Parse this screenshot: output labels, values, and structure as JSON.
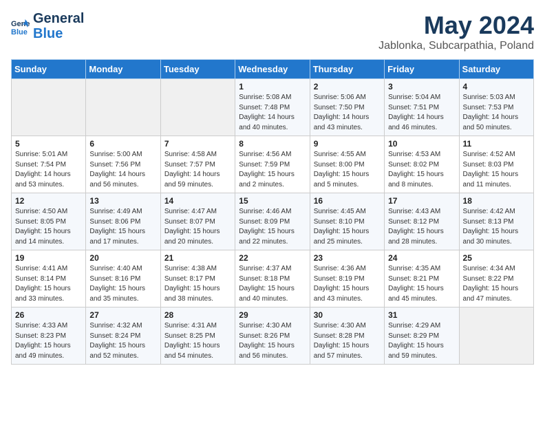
{
  "header": {
    "logo_line1": "General",
    "logo_line2": "Blue",
    "month_title": "May 2024",
    "subtitle": "Jablonka, Subcarpathia, Poland"
  },
  "days_of_week": [
    "Sunday",
    "Monday",
    "Tuesday",
    "Wednesday",
    "Thursday",
    "Friday",
    "Saturday"
  ],
  "weeks": [
    [
      {
        "day": "",
        "sunrise": "",
        "sunset": "",
        "daylight": ""
      },
      {
        "day": "",
        "sunrise": "",
        "sunset": "",
        "daylight": ""
      },
      {
        "day": "",
        "sunrise": "",
        "sunset": "",
        "daylight": ""
      },
      {
        "day": "1",
        "sunrise": "Sunrise: 5:08 AM",
        "sunset": "Sunset: 7:48 PM",
        "daylight": "Daylight: 14 hours and 40 minutes."
      },
      {
        "day": "2",
        "sunrise": "Sunrise: 5:06 AM",
        "sunset": "Sunset: 7:50 PM",
        "daylight": "Daylight: 14 hours and 43 minutes."
      },
      {
        "day": "3",
        "sunrise": "Sunrise: 5:04 AM",
        "sunset": "Sunset: 7:51 PM",
        "daylight": "Daylight: 14 hours and 46 minutes."
      },
      {
        "day": "4",
        "sunrise": "Sunrise: 5:03 AM",
        "sunset": "Sunset: 7:53 PM",
        "daylight": "Daylight: 14 hours and 50 minutes."
      }
    ],
    [
      {
        "day": "5",
        "sunrise": "Sunrise: 5:01 AM",
        "sunset": "Sunset: 7:54 PM",
        "daylight": "Daylight: 14 hours and 53 minutes."
      },
      {
        "day": "6",
        "sunrise": "Sunrise: 5:00 AM",
        "sunset": "Sunset: 7:56 PM",
        "daylight": "Daylight: 14 hours and 56 minutes."
      },
      {
        "day": "7",
        "sunrise": "Sunrise: 4:58 AM",
        "sunset": "Sunset: 7:57 PM",
        "daylight": "Daylight: 14 hours and 59 minutes."
      },
      {
        "day": "8",
        "sunrise": "Sunrise: 4:56 AM",
        "sunset": "Sunset: 7:59 PM",
        "daylight": "Daylight: 15 hours and 2 minutes."
      },
      {
        "day": "9",
        "sunrise": "Sunrise: 4:55 AM",
        "sunset": "Sunset: 8:00 PM",
        "daylight": "Daylight: 15 hours and 5 minutes."
      },
      {
        "day": "10",
        "sunrise": "Sunrise: 4:53 AM",
        "sunset": "Sunset: 8:02 PM",
        "daylight": "Daylight: 15 hours and 8 minutes."
      },
      {
        "day": "11",
        "sunrise": "Sunrise: 4:52 AM",
        "sunset": "Sunset: 8:03 PM",
        "daylight": "Daylight: 15 hours and 11 minutes."
      }
    ],
    [
      {
        "day": "12",
        "sunrise": "Sunrise: 4:50 AM",
        "sunset": "Sunset: 8:05 PM",
        "daylight": "Daylight: 15 hours and 14 minutes."
      },
      {
        "day": "13",
        "sunrise": "Sunrise: 4:49 AM",
        "sunset": "Sunset: 8:06 PM",
        "daylight": "Daylight: 15 hours and 17 minutes."
      },
      {
        "day": "14",
        "sunrise": "Sunrise: 4:47 AM",
        "sunset": "Sunset: 8:07 PM",
        "daylight": "Daylight: 15 hours and 20 minutes."
      },
      {
        "day": "15",
        "sunrise": "Sunrise: 4:46 AM",
        "sunset": "Sunset: 8:09 PM",
        "daylight": "Daylight: 15 hours and 22 minutes."
      },
      {
        "day": "16",
        "sunrise": "Sunrise: 4:45 AM",
        "sunset": "Sunset: 8:10 PM",
        "daylight": "Daylight: 15 hours and 25 minutes."
      },
      {
        "day": "17",
        "sunrise": "Sunrise: 4:43 AM",
        "sunset": "Sunset: 8:12 PM",
        "daylight": "Daylight: 15 hours and 28 minutes."
      },
      {
        "day": "18",
        "sunrise": "Sunrise: 4:42 AM",
        "sunset": "Sunset: 8:13 PM",
        "daylight": "Daylight: 15 hours and 30 minutes."
      }
    ],
    [
      {
        "day": "19",
        "sunrise": "Sunrise: 4:41 AM",
        "sunset": "Sunset: 8:14 PM",
        "daylight": "Daylight: 15 hours and 33 minutes."
      },
      {
        "day": "20",
        "sunrise": "Sunrise: 4:40 AM",
        "sunset": "Sunset: 8:16 PM",
        "daylight": "Daylight: 15 hours and 35 minutes."
      },
      {
        "day": "21",
        "sunrise": "Sunrise: 4:38 AM",
        "sunset": "Sunset: 8:17 PM",
        "daylight": "Daylight: 15 hours and 38 minutes."
      },
      {
        "day": "22",
        "sunrise": "Sunrise: 4:37 AM",
        "sunset": "Sunset: 8:18 PM",
        "daylight": "Daylight: 15 hours and 40 minutes."
      },
      {
        "day": "23",
        "sunrise": "Sunrise: 4:36 AM",
        "sunset": "Sunset: 8:19 PM",
        "daylight": "Daylight: 15 hours and 43 minutes."
      },
      {
        "day": "24",
        "sunrise": "Sunrise: 4:35 AM",
        "sunset": "Sunset: 8:21 PM",
        "daylight": "Daylight: 15 hours and 45 minutes."
      },
      {
        "day": "25",
        "sunrise": "Sunrise: 4:34 AM",
        "sunset": "Sunset: 8:22 PM",
        "daylight": "Daylight: 15 hours and 47 minutes."
      }
    ],
    [
      {
        "day": "26",
        "sunrise": "Sunrise: 4:33 AM",
        "sunset": "Sunset: 8:23 PM",
        "daylight": "Daylight: 15 hours and 49 minutes."
      },
      {
        "day": "27",
        "sunrise": "Sunrise: 4:32 AM",
        "sunset": "Sunset: 8:24 PM",
        "daylight": "Daylight: 15 hours and 52 minutes."
      },
      {
        "day": "28",
        "sunrise": "Sunrise: 4:31 AM",
        "sunset": "Sunset: 8:25 PM",
        "daylight": "Daylight: 15 hours and 54 minutes."
      },
      {
        "day": "29",
        "sunrise": "Sunrise: 4:30 AM",
        "sunset": "Sunset: 8:26 PM",
        "daylight": "Daylight: 15 hours and 56 minutes."
      },
      {
        "day": "30",
        "sunrise": "Sunrise: 4:30 AM",
        "sunset": "Sunset: 8:28 PM",
        "daylight": "Daylight: 15 hours and 57 minutes."
      },
      {
        "day": "31",
        "sunrise": "Sunrise: 4:29 AM",
        "sunset": "Sunset: 8:29 PM",
        "daylight": "Daylight: 15 hours and 59 minutes."
      },
      {
        "day": "",
        "sunrise": "",
        "sunset": "",
        "daylight": ""
      }
    ]
  ]
}
